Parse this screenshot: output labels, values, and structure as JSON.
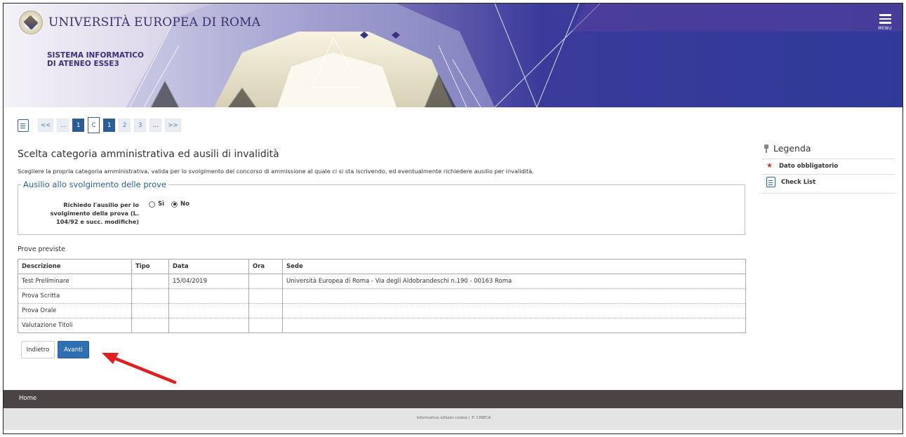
{
  "header": {
    "university_name": "UNIVERSITÀ EUROPEA DI ROMA",
    "system_line1": "SISTEMA INFORMATICO",
    "system_line2": "DI ATENEO ESSE3",
    "menu_label": "MENU"
  },
  "pager": {
    "items": [
      {
        "label": "<<",
        "style": "light"
      },
      {
        "label": "...",
        "style": "light"
      },
      {
        "label": "1",
        "style": "dark"
      },
      {
        "label": "C",
        "style": "current"
      },
      {
        "label": "1",
        "style": "dark"
      },
      {
        "label": "2",
        "style": "light"
      },
      {
        "label": "3",
        "style": "light"
      },
      {
        "label": "...",
        "style": "light"
      },
      {
        "label": ">>",
        "style": "light"
      }
    ]
  },
  "main": {
    "title": "Scelta categoria amministrativa ed ausili di invalidità",
    "description": "Scegliere la propria categoria amministrativa, valida per lo svolgimento del concorso di ammissione al quale ci si sta iscrivendo, ed eventualmente richiedere ausilio per invalidità.",
    "fieldset_legend": "Ausilio allo svolgimento delle prove",
    "field_label_line1": "Richiedo l'ausilio per lo",
    "field_label_line2": "svolgimento della prova (L.",
    "field_label_line3": "104/92 e succ. modifiche)",
    "radio_yes": "Sì",
    "radio_no": "No",
    "selected": "No",
    "prove_title": "Prove previste",
    "table_headers": [
      "Descrizione",
      "Tipo",
      "Data",
      "Ora",
      "Sede"
    ],
    "rows": [
      [
        "Test Preliminare",
        "",
        "15/04/2019",
        "",
        "Università Europea di Roma - Via degli Aldobrandeschi n.190 - 00163 Roma"
      ],
      [
        "Prova Scritta",
        "",
        "",
        "",
        ""
      ],
      [
        "Prova Orale",
        "",
        "",
        "",
        ""
      ],
      [
        "Valutazione Titoli",
        "",
        "",
        "",
        ""
      ]
    ],
    "back_label": "Indietro",
    "next_label": "Avanti"
  },
  "sidebar": {
    "legenda": "Legenda",
    "required": "Dato obbligatorio",
    "checklist": "Check List"
  },
  "footer": {
    "home": "Home",
    "credits": "Informativa utilizzo cookie | © CINECA"
  },
  "colors": {
    "primary": "#2f6fb3",
    "header_purple": "#3a3a9a",
    "annotation_arrow": "#e02020",
    "footer_dark": "#4a4444"
  }
}
